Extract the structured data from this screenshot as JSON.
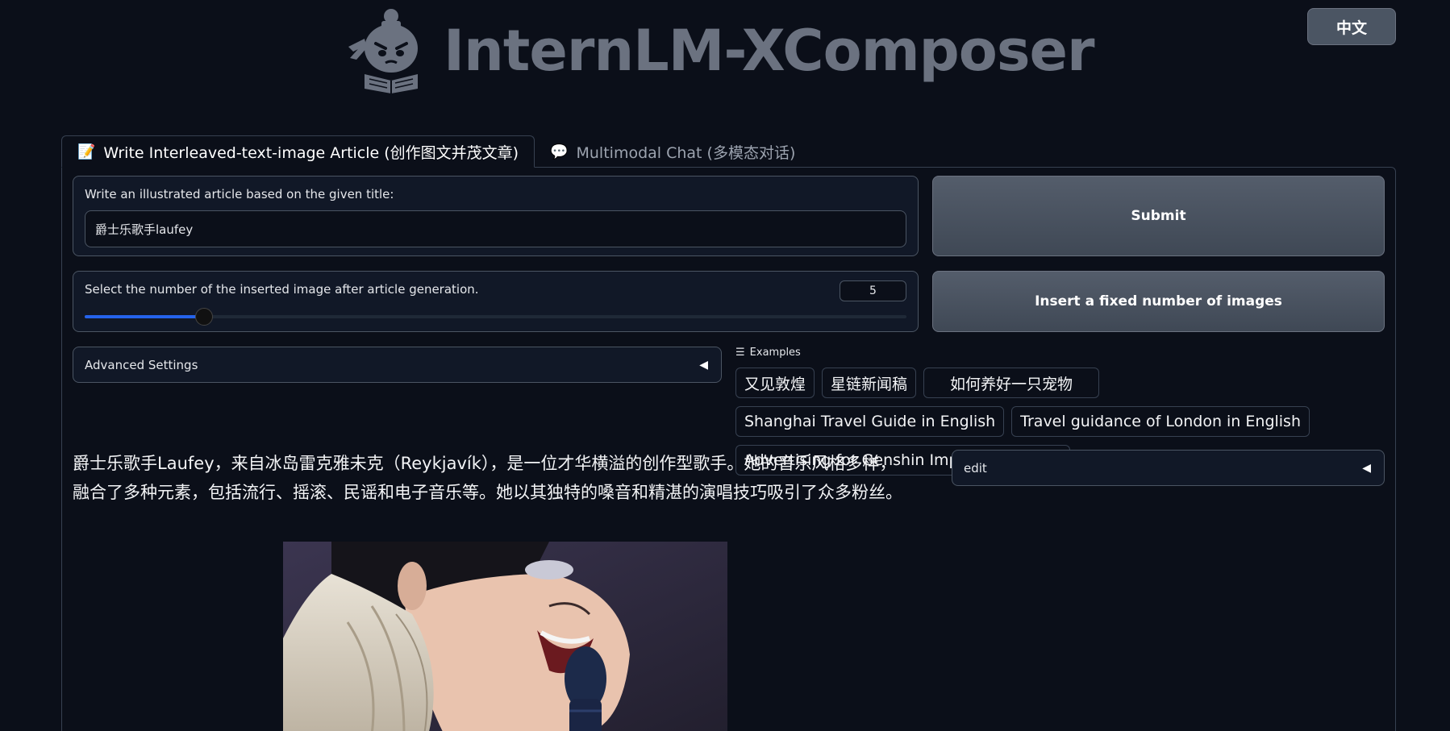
{
  "language_button": "中文",
  "app_title": "InternLM-XComposer",
  "tabs": [
    {
      "icon": "📝",
      "label": "Write Interleaved-text-image Article (创作图文并茂文章)"
    },
    {
      "icon": "💬",
      "label": "Multimodal Chat (多模态对话)"
    }
  ],
  "title_input": {
    "label": "Write an illustrated article based on the given title:",
    "value": "爵士乐歌手laufey"
  },
  "submit_label": "Submit",
  "image_count": {
    "label": "Select the number of the inserted image after article generation.",
    "value": "5",
    "slider_fraction": 0.145
  },
  "insert_label": "Insert a fixed number of images",
  "advanced_settings_label": "Advanced Settings",
  "examples": {
    "heading": "Examples",
    "items": [
      "又见敦煌",
      "星链新闻稿",
      "如何养好一只宠物",
      "Shanghai Travel Guide in English",
      "Travel guidance of London in English",
      "Advertising for Genshin Impact in English"
    ]
  },
  "article_paragraph": "爵士乐歌手Laufey，来自冰岛雷克雅未克（Reykjavík），是一位才华横溢的创作型歌手。她的音乐风格多样，融合了多种元素，包括流行、摇滚、民谣和电子音乐等。她以其独特的嗓音和精湛的演唱技巧吸引了众多粉丝。",
  "edit_label": "edit",
  "colors": {
    "background": "#0b0f19",
    "accent": "#2563eb",
    "button": "#4b5563"
  }
}
